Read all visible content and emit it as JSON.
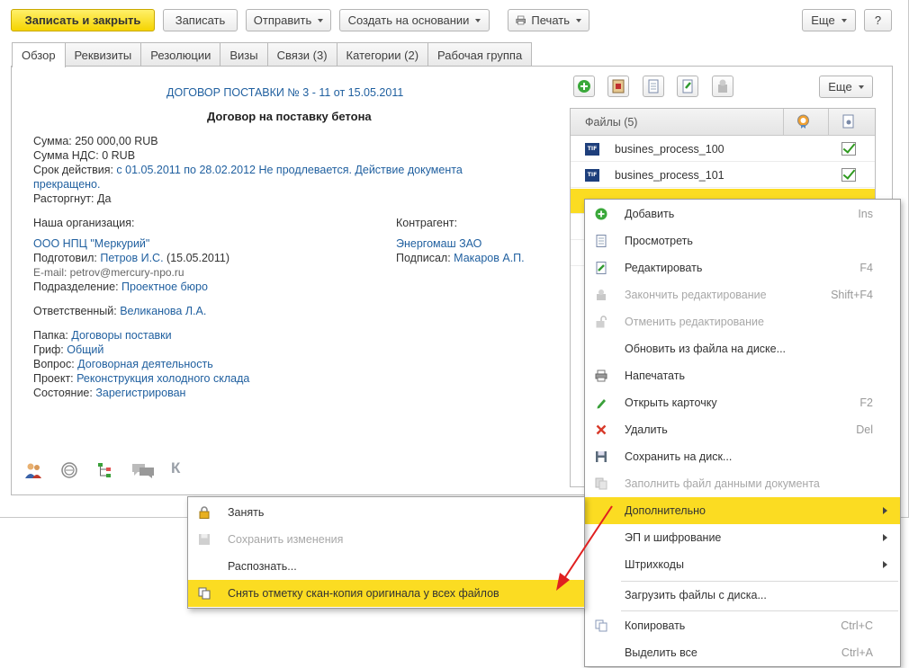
{
  "toolbar": {
    "save_close": "Записать и закрыть",
    "save": "Записать",
    "send": "Отправить",
    "create_based": "Создать на основании",
    "print": "Печать",
    "more": "Еще",
    "help": "?"
  },
  "tabs": [
    {
      "label": "Обзор",
      "active": true
    },
    {
      "label": "Реквизиты"
    },
    {
      "label": "Резолюции"
    },
    {
      "label": "Визы"
    },
    {
      "label": "Связи (3)"
    },
    {
      "label": "Категории (2)"
    },
    {
      "label": "Рабочая группа"
    }
  ],
  "doc": {
    "heading_link": "ДОГОВОР ПОСТАВКИ",
    "heading_rest": " № 3 - 11 от 15.05.2011",
    "title": "Договор на поставку бетона",
    "sum": "Сумма: 250 000,00 RUB",
    "vat": "Сумма НДС: 0 RUB",
    "term_label": "Срок действия:",
    "term_value": " с 01.05.2011 по 28.02.2012 Не продлевается. Действие документа",
    "term_value2": "прекращено.",
    "terminated": "Расторгнут: Да",
    "our_org_label": "Наша организация:",
    "our_org": "ООО НПЦ \"Меркурий\"",
    "prepared_label": "Подготовил: ",
    "prepared_by": "Петров И.С.",
    "prepared_date": " (15.05.2011)",
    "email": "E-mail:  petrov@mercury-npo.ru",
    "dept_label": "Подразделение: ",
    "dept": "Проектное бюро",
    "counterparty_label": "Контрагент:",
    "counterparty": "Энергомаш ЗАО",
    "signed_label": "Подписал: ",
    "signed_by": "Макаров А.П.",
    "responsible_label": "Ответственный: ",
    "responsible": "Великанова Л.А.",
    "folder_label": "Папка: ",
    "folder": "Договоры поставки",
    "stamp_label": "Гриф: ",
    "stamp": "Общий",
    "question_label": "Вопрос: ",
    "question": "Договорная деятельность",
    "project_label": "Проект: ",
    "project": "Реконструкция холодного склада",
    "state_label": "Состояние: ",
    "state": "Зарегистрирован",
    "bottom_letter": "К"
  },
  "files": {
    "more": "Еще",
    "header": "Файлы (5)",
    "items": [
      {
        "name": "busines_process_100",
        "type": "TIF"
      },
      {
        "name": "busines_process_101",
        "type": "TIF"
      }
    ]
  },
  "context_menu": [
    {
      "label": "Добавить",
      "shortcut": "Ins",
      "icon": "plus-circle-icon"
    },
    {
      "label": "Просмотреть",
      "icon": "document-icon"
    },
    {
      "label": "Редактировать",
      "shortcut": "F4",
      "icon": "edit-document-icon"
    },
    {
      "label": "Закончить редактирование",
      "shortcut": "Shift+F4",
      "disabled": true,
      "icon": "finish-edit-icon"
    },
    {
      "label": "Отменить редактирование",
      "disabled": true,
      "icon": "unlock-icon"
    },
    {
      "label": "Обновить из файла на диске..."
    },
    {
      "label": "Напечатать",
      "icon": "printer-icon"
    },
    {
      "label": "Открыть карточку",
      "shortcut": "F2",
      "icon": "pencil-icon"
    },
    {
      "label": "Удалить",
      "shortcut": "Del",
      "icon": "delete-x-icon"
    },
    {
      "label": "Сохранить на диск...",
      "icon": "save-disk-icon"
    },
    {
      "label": "Заполнить файл данными документа",
      "disabled": true,
      "icon": "fill-doc-icon"
    },
    {
      "label": "Дополнительно",
      "highlighted": true,
      "submenu": true
    },
    {
      "label": "ЭП и шифрование",
      "submenu": true
    },
    {
      "label": "Штрихкоды",
      "submenu": true
    },
    {
      "label": "Загрузить файлы с диска..."
    },
    {
      "label": "Копировать",
      "shortcut": "Ctrl+C",
      "icon": "copy-icon"
    },
    {
      "label": "Выделить все",
      "shortcut": "Ctrl+A"
    }
  ],
  "submenu": [
    {
      "label": "Занять",
      "icon": "lock-icon"
    },
    {
      "label": "Сохранить изменения",
      "disabled": true,
      "icon": "save-changes-icon"
    },
    {
      "label": "Распознать..."
    },
    {
      "label": "Снять отметку скан-копия оригинала у всех файлов",
      "highlighted": true,
      "icon": "scan-copy-icon"
    }
  ],
  "colors": {
    "accent_yellow": "#fbdc22",
    "link": "#1f5f9f",
    "arrow": "#e02020"
  }
}
